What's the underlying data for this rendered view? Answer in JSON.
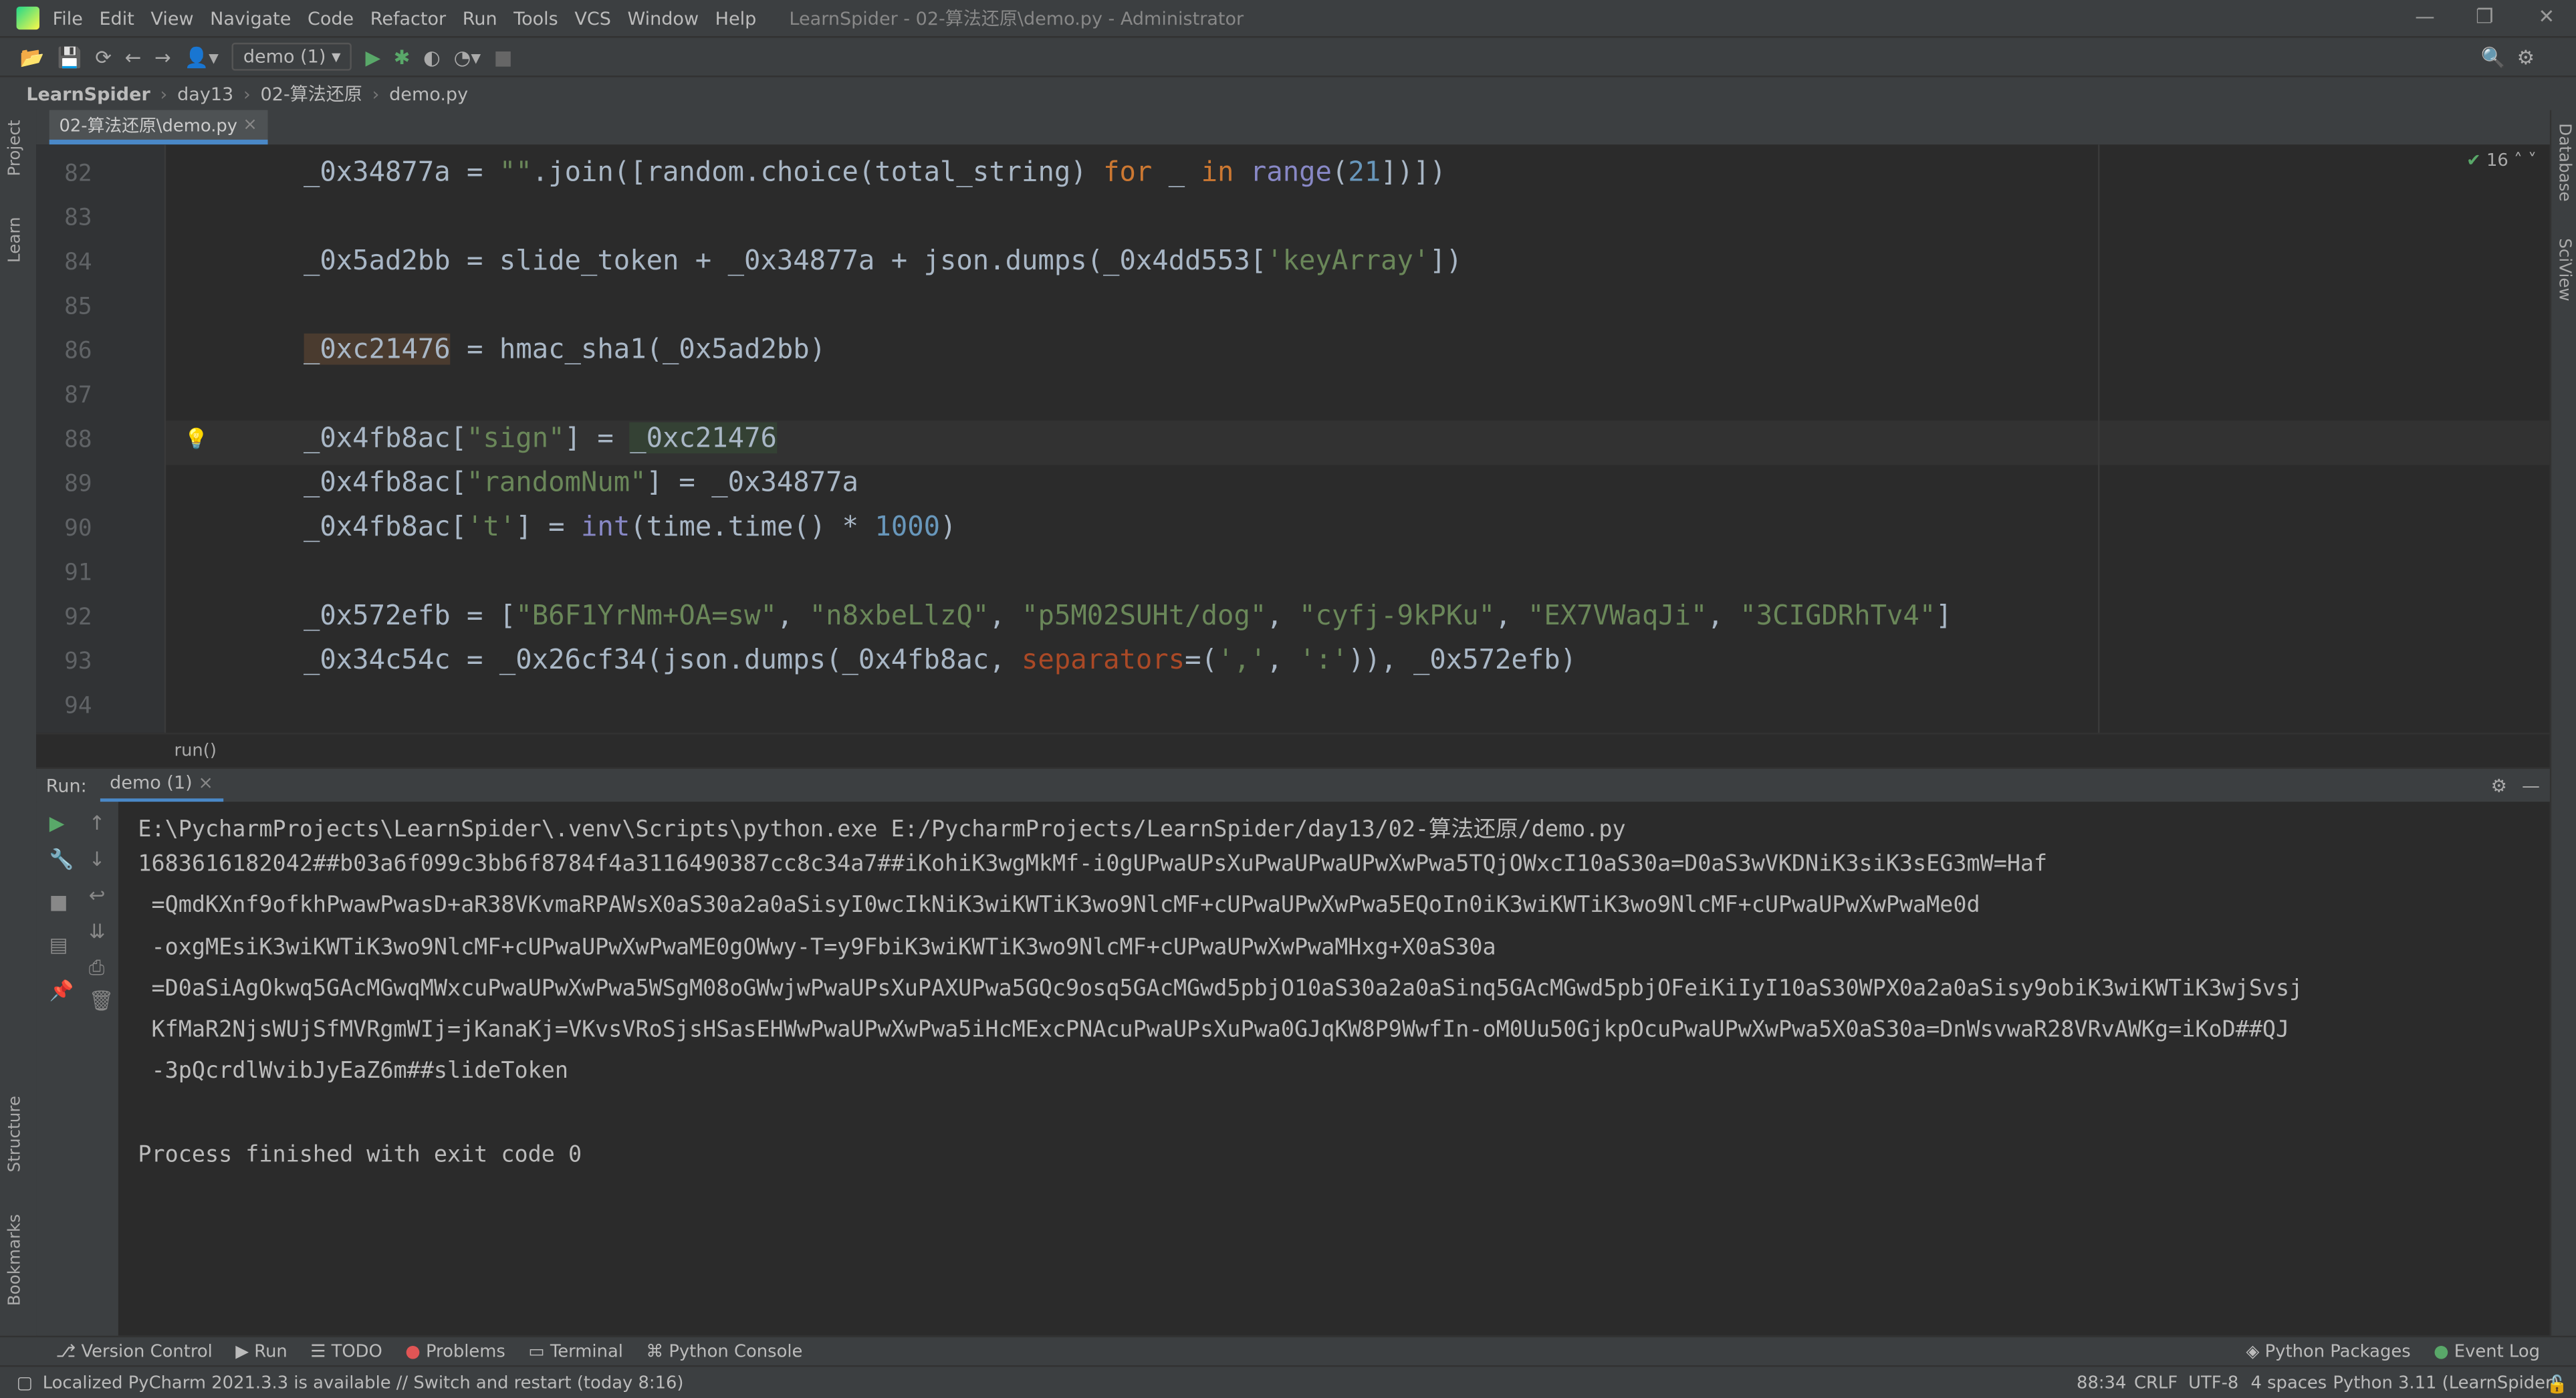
{
  "menubar": {
    "items": [
      "File",
      "Edit",
      "View",
      "Navigate",
      "Code",
      "Refactor",
      "Run",
      "Tools",
      "VCS",
      "Window",
      "Help"
    ],
    "title": "LearnSpider - 02-算法还原\\demo.py - Administrator"
  },
  "toolbar": {
    "run_config": "demo (1)"
  },
  "breadcrumb": [
    "LearnSpider",
    "day13",
    "02-算法还原",
    "demo.py"
  ],
  "left_strip": [
    "Project",
    "Learn",
    "Structure",
    "Bookmarks"
  ],
  "right_strip": [
    "Database",
    "SciView"
  ],
  "editor": {
    "tab": "02-算法还原\\demo.py",
    "inspection_count": "16",
    "current_line": "88",
    "lines": [
      {
        "n": "82",
        "tokens": [
          [
            "    _0x34877a = ",
            ""
          ],
          [
            "\"\"",
            "str"
          ],
          [
            ".join([random.choice(total_string) ",
            ""
          ],
          [
            "for",
            "kw"
          ],
          [
            " _ ",
            ""
          ],
          [
            "in",
            "kw"
          ],
          [
            " ",
            ""
          ],
          [
            "range",
            "bi"
          ],
          [
            "(",
            ""
          ],
          [
            "21",
            "num"
          ],
          [
            "])])",
            ""
          ]
        ]
      },
      {
        "n": "83",
        "tokens": []
      },
      {
        "n": "84",
        "tokens": [
          [
            "    _0x5ad2bb = slide_token + _0x34877a + json.dumps(_0x4dd553[",
            ""
          ],
          [
            "'keyArray'",
            "str"
          ],
          [
            "])",
            ""
          ]
        ]
      },
      {
        "n": "85",
        "tokens": []
      },
      {
        "n": "86",
        "tokens": [
          [
            "    ",
            ""
          ],
          [
            "_0xc21476",
            "hl"
          ],
          [
            " = hmac_sha1(_0x5ad2bb)",
            ""
          ]
        ]
      },
      {
        "n": "87",
        "tokens": []
      },
      {
        "n": "88",
        "tokens": [
          [
            "    _0x4fb8ac[",
            ""
          ],
          [
            "\"sign\"",
            "str"
          ],
          [
            "] = ",
            ""
          ],
          [
            "_0xc21476",
            "hl2"
          ]
        ]
      },
      {
        "n": "89",
        "tokens": [
          [
            "    _0x4fb8ac[",
            ""
          ],
          [
            "\"randomNum\"",
            "str"
          ],
          [
            "] = _0x34877a",
            ""
          ]
        ]
      },
      {
        "n": "90",
        "tokens": [
          [
            "    _0x4fb8ac[",
            ""
          ],
          [
            "'t'",
            "str"
          ],
          [
            "] = ",
            ""
          ],
          [
            "int",
            "bi"
          ],
          [
            "(time.time() * ",
            ""
          ],
          [
            "1000",
            "num"
          ],
          [
            ")",
            ""
          ]
        ]
      },
      {
        "n": "91",
        "tokens": []
      },
      {
        "n": "92",
        "tokens": [
          [
            "    _0x572efb = [",
            ""
          ],
          [
            "\"B6F1YrNm+OA=sw\"",
            "str"
          ],
          [
            ", ",
            ""
          ],
          [
            "\"n8xbeLlzQ\"",
            "str"
          ],
          [
            ", ",
            ""
          ],
          [
            "\"p5M02SUHt/dog\"",
            "str"
          ],
          [
            ", ",
            ""
          ],
          [
            "\"cyfj-9kPKu\"",
            "str"
          ],
          [
            ", ",
            ""
          ],
          [
            "\"EX7VWaqJi\"",
            "str"
          ],
          [
            ", ",
            ""
          ],
          [
            "\"3CIGDRhTv4\"",
            "str"
          ],
          [
            "]",
            ""
          ]
        ]
      },
      {
        "n": "93",
        "tokens": [
          [
            "    _0x34c54c = _0x26cf34(json.dumps(_0x4fb8ac, ",
            ""
          ],
          [
            "separators",
            "par"
          ],
          [
            "=(",
            ""
          ],
          [
            "','",
            "str"
          ],
          [
            ", ",
            ""
          ],
          [
            "':'",
            "str"
          ],
          [
            ")), _0x572efb)",
            ""
          ]
        ]
      },
      {
        "n": "94",
        "tokens": []
      }
    ],
    "footer_crumb": "run()"
  },
  "run": {
    "label": "Run:",
    "tab": "demo (1)",
    "output": [
      "E:\\PycharmProjects\\LearnSpider\\.venv\\Scripts\\python.exe E:/PycharmProjects/LearnSpider/day13/02-算法还原/demo.py",
      "1683616182042##b03a6f099c3bb6f8784f4a3116490387cc8c34a7##iKohiK3wgMkMf-i0gUPwaUPsXuPwaUPwaUPwXwPwa5TQjOWxcI10aS30a=D0aS3wVKDNiK3siK3sEG3mW=Haf",
      " =QmdKXnf9ofkhPwawPwasD+aR38VKvmaRPAWsX0aS30a2a0aSisyI0wcIkNiK3wiKWTiK3wo9NlcMF+cUPwaUPwXwPwa5EQoIn0iK3wiKWTiK3wo9NlcMF+cUPwaUPwXwPwaMe0d",
      " -oxgMEsiK3wiKWTiK3wo9NlcMF+cUPwaUPwXwPwaME0gOWwy-T=y9FbiK3wiKWTiK3wo9NlcMF+cUPwaUPwXwPwaMHxg+X0aS30a",
      " =D0aSiAgOkwq5GAcMGwqMWxcuPwaUPwXwPwa5WSgM08oGWwjwPwaUPsXuPAXUPwa5GQc9osq5GAcMGwd5pbjO10aS30a2a0aSinq5GAcMGwd5pbjOFeiKiIyI10aS30WPX0a2a0aSisy9obiK3wiKWTiK3wjSvsj",
      " KfMaR2NjsWUjSfMVRgmWIj=jKanaKj=VKvsVRoSjsHSasEHWwPwaUPwXwPwa5iHcMExcPNAcuPwaUPsXuPwa0GJqKW8P9WwfIn-oM0Uu50GjkpOcuPwaUPwXwPwa5X0aS30a=DnWsvwaR28VRvAWKg=iKoD##QJ",
      " -3pQcrdlWvibJyEaZ6m##slideToken",
      "",
      "Process finished with exit code 0"
    ]
  },
  "bottom_tabs": [
    "Version Control",
    "Run",
    "TODO",
    "Problems",
    "Terminal",
    "Python Console",
    "Python Packages",
    "Event Log"
  ],
  "status": {
    "message": "Localized PyCharm 2021.3.3 is available // Switch and restart (today 8:16)",
    "position": "88:34",
    "line_sep": "CRLF",
    "encoding": "UTF-8",
    "indent": "4 spaces",
    "interpreter": "Python 3.11 (LearnSpider)"
  },
  "colors": {
    "bg": "#2b2b2b",
    "panel": "#3c3f41",
    "string": "#6a8759",
    "keyword": "#cc7832",
    "number": "#6897bb",
    "accent": "#4a88c7"
  }
}
